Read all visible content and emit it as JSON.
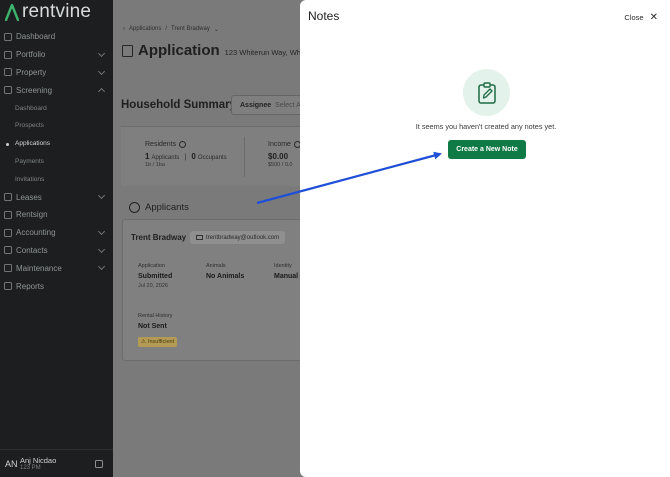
{
  "brand": {
    "name": "rentvine"
  },
  "sidebar": {
    "items": [
      {
        "label": "Dashboard"
      },
      {
        "label": "Portfolio"
      },
      {
        "label": "Property"
      },
      {
        "label": "Screening"
      },
      {
        "label": "Dashboard"
      },
      {
        "label": "Prospects"
      },
      {
        "label": "Applications"
      },
      {
        "label": "Payments"
      },
      {
        "label": "Invitations"
      },
      {
        "label": "Leases"
      },
      {
        "label": "Rentsign"
      },
      {
        "label": "Accounting"
      },
      {
        "label": "Contacts"
      },
      {
        "label": "Maintenance"
      },
      {
        "label": "Reports"
      }
    ],
    "user": {
      "initials": "AN",
      "name": "Anj Nicdao",
      "sub": "123 PM"
    }
  },
  "main": {
    "breadcrumb": {
      "root": "Applications",
      "sep": "/",
      "current": "Trent Bradway"
    },
    "title": "Application",
    "address": "123 Whiterun Way, Whiteru",
    "household_title": "Household Summary",
    "assignee": {
      "label": "Assignee",
      "placeholder": "Select A"
    },
    "residents": {
      "label": "Residents",
      "applicants_count": "1",
      "applicants_label": "Applicants",
      "occupants_count": "0",
      "occupants_label": "Occupants",
      "sub": "1b / 1ba"
    },
    "income": {
      "label": "Income",
      "value": "$0.00",
      "sub": "$500 / 0.0"
    },
    "applicants_title": "Applicants",
    "applicant": {
      "name": "Trent Bradway",
      "email": "trentbradway@outlook.com",
      "application": {
        "label": "Application",
        "value": "Submitted",
        "date": "Jul 20, 2026"
      },
      "animals": {
        "label": "Animals",
        "value": "No Animals"
      },
      "identity": {
        "label": "Identity",
        "value": "Manual"
      },
      "rental_history": {
        "label": "Rental History",
        "value": "Not Sent",
        "badge": "Insufficient"
      }
    }
  },
  "notes_panel": {
    "title": "Notes",
    "close_label": "Close",
    "empty_message": "It seems you haven't created any notes yet.",
    "create_button": "Create a New Note",
    "icon": "clipboard-edit-icon",
    "accent_color": "#0f7a45",
    "annotation_arrow_color": "#1f4fd6"
  }
}
